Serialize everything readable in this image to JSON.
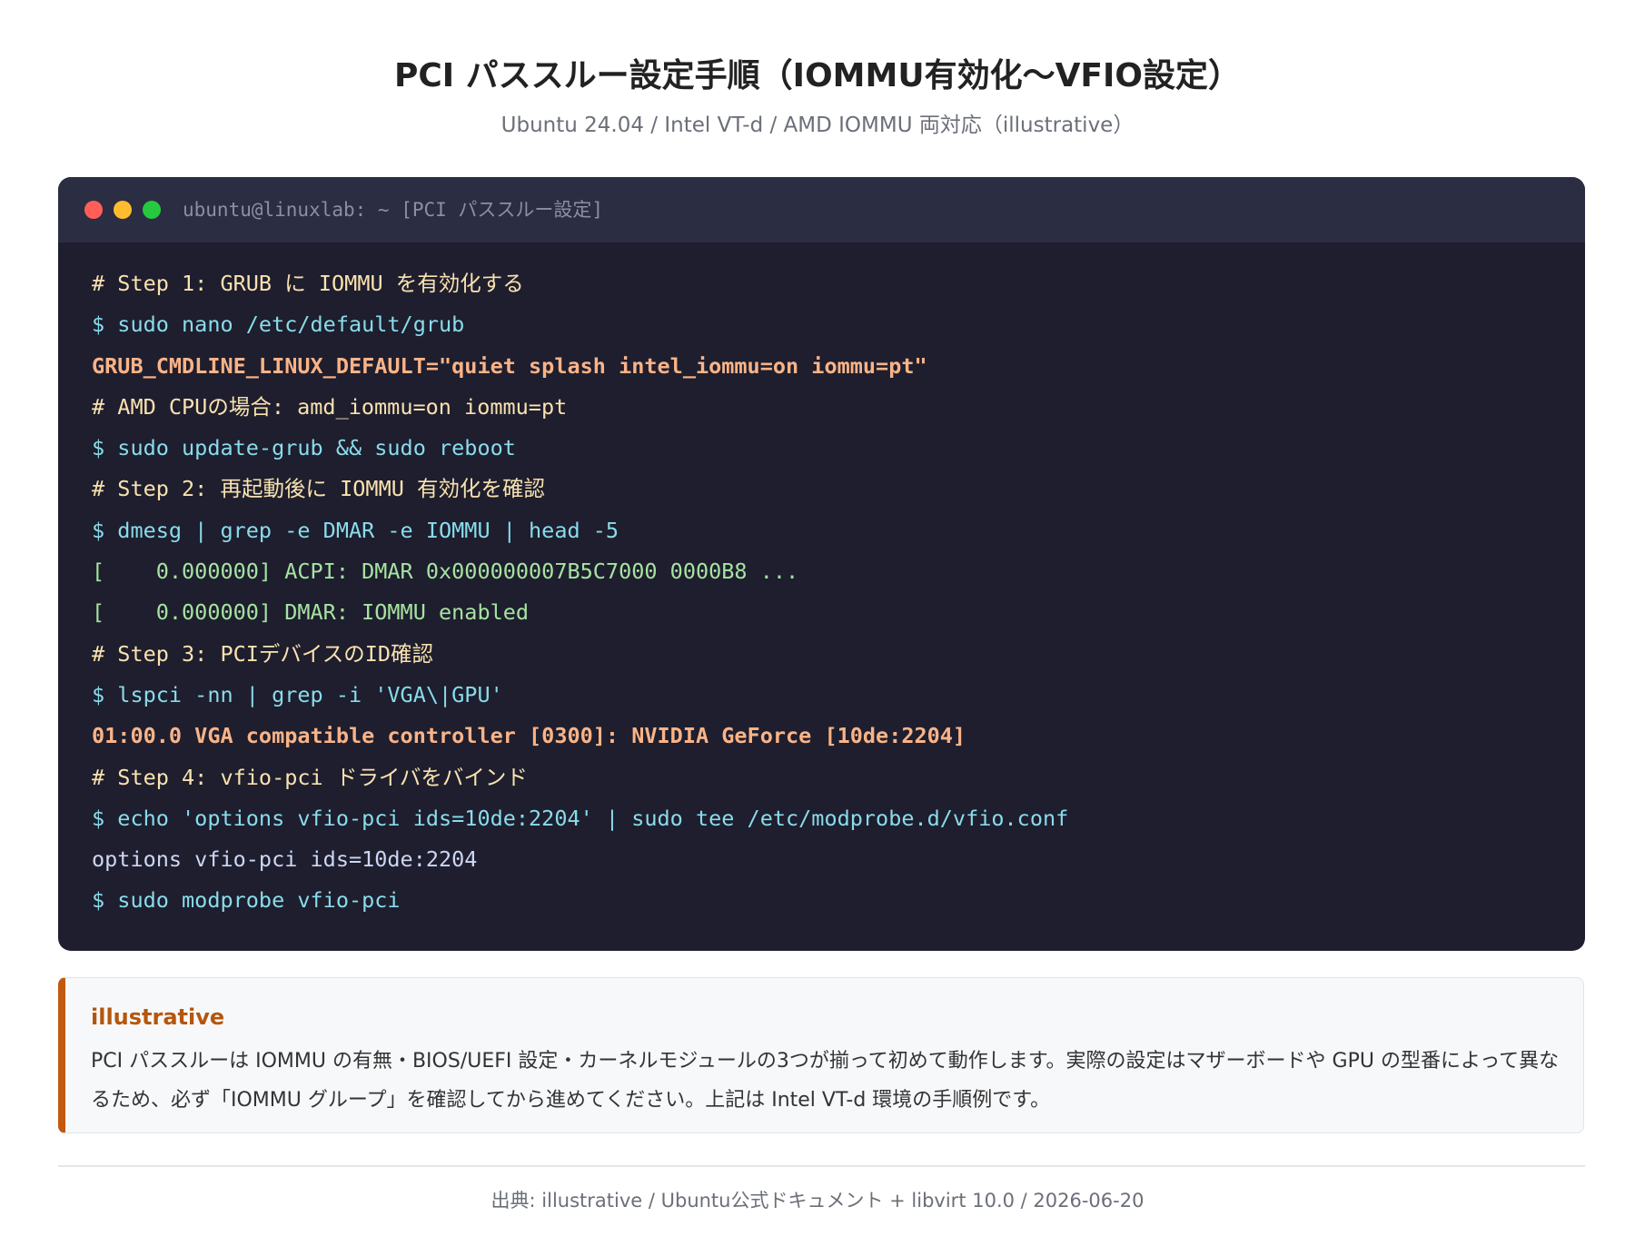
{
  "header": {
    "title": "PCI パススルー設定手順（IOMMU有効化〜VFIO設定）",
    "subtitle": "Ubuntu 24.04 / Intel VT-d / AMD IOMMU 両対応（illustrative）"
  },
  "terminal": {
    "title": "ubuntu@linuxlab: ~ [PCI パススルー設定]",
    "lines": [
      {
        "type": "comment",
        "text": "# Step 1: GRUB に IOMMU を有効化する"
      },
      {
        "type": "cmd",
        "text": "$ sudo nano /etc/default/grub"
      },
      {
        "type": "highlight",
        "text": "GRUB_CMDLINE_LINUX_DEFAULT=\"quiet splash intel_iommu=on iommu=pt\""
      },
      {
        "type": "comment",
        "text": "# AMD CPUの場合: amd_iommu=on iommu=pt"
      },
      {
        "type": "cmd",
        "text": "$ sudo update-grub && sudo reboot"
      },
      {
        "type": "comment",
        "text": "# Step 2: 再起動後に IOMMU 有効化を確認"
      },
      {
        "type": "cmd",
        "text": "$ dmesg | grep -e DMAR -e IOMMU | head -5"
      },
      {
        "type": "output-green",
        "text": "[    0.000000] ACPI: DMAR 0x000000007B5C7000 0000B8 ..."
      },
      {
        "type": "output-green",
        "text": "[    0.000000] DMAR: IOMMU enabled"
      },
      {
        "type": "comment",
        "text": "# Step 3: PCIデバイスのID確認"
      },
      {
        "type": "cmd",
        "text": "$ lspci -nn | grep -i 'VGA\\|GPU'"
      },
      {
        "type": "highlight",
        "text": "01:00.0 VGA compatible controller [0300]: NVIDIA GeForce [10de:2204]"
      },
      {
        "type": "comment",
        "text": "# Step 4: vfio-pci ドライバをバインド"
      },
      {
        "type": "cmd",
        "text": "$ echo 'options vfio-pci ids=10de:2204' | sudo tee /etc/modprobe.d/vfio.conf"
      },
      {
        "type": "output",
        "text": "options vfio-pci ids=10de:2204"
      },
      {
        "type": "cmd",
        "text": "$ sudo modprobe vfio-pci"
      }
    ]
  },
  "note": {
    "label": "illustrative",
    "text": "PCI パススルーは IOMMU の有無・BIOS/UEFI 設定・カーネルモジュールの3つが揃って初めて動作します。実際の設定はマザーボードや GPU の型番によって異なるため、必ず「IOMMU グループ」を確認してから進めてください。上記は Intel VT-d 環境の手順例です。"
  },
  "footer": {
    "text": "出典: illustrative / Ubuntu公式ドキュメント + libvirt 10.0 / 2026-06-20"
  },
  "colors": {
    "terminal_bg": "#1e1e2e",
    "titlebar_bg": "#2b2d42",
    "comment": "#f9e2af",
    "command": "#89dceb",
    "highlight": "#fab387",
    "output_green": "#a6e3a1",
    "accent": "#c2590f"
  },
  "icons": {
    "window_controls": [
      "close-dot-icon",
      "minimize-dot-icon",
      "maximize-dot-icon"
    ]
  }
}
